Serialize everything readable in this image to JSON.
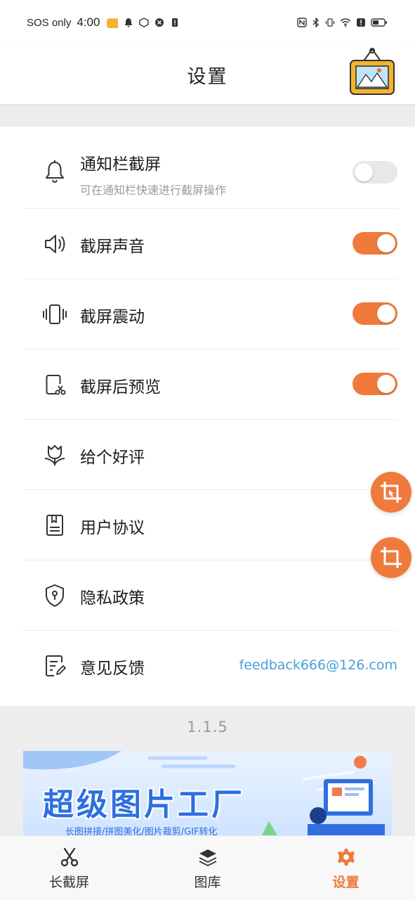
{
  "status_bar": {
    "carrier": "SOS only",
    "time": "4:00"
  },
  "header": {
    "title": "设置"
  },
  "settings": {
    "rows": [
      {
        "label": "通知栏截屏",
        "sub": "可在通知栏快速进行截屏操作",
        "toggle": false,
        "icon": "bell-icon"
      },
      {
        "label": "截屏声音",
        "toggle": true,
        "icon": "speaker-icon"
      },
      {
        "label": "截屏震动",
        "toggle": true,
        "icon": "vibrate-icon"
      },
      {
        "label": "截屏后预览",
        "toggle": true,
        "icon": "phone-scissors-icon"
      },
      {
        "label": "给个好评",
        "icon": "tulip-icon"
      },
      {
        "label": "用户协议",
        "icon": "document-icon"
      },
      {
        "label": "隐私政策",
        "icon": "shield-icon"
      },
      {
        "label": "意见反馈",
        "right_text": "feedback666@126.com",
        "icon": "edit-note-icon"
      }
    ]
  },
  "version": "1.1.5",
  "banner": {
    "title": "超级图片工厂",
    "subtitle": "长图拼接/拼图美化/图片裁剪/GIF转化"
  },
  "bottom_nav": {
    "items": [
      {
        "label": "长截屏",
        "icon": "scissors-icon",
        "active": false
      },
      {
        "label": "图库",
        "icon": "layers-icon",
        "active": false
      },
      {
        "label": "设置",
        "icon": "gear-icon",
        "active": true
      }
    ]
  },
  "colors": {
    "accent": "#ef7a3c",
    "link": "#4a9fd6",
    "toggle_off": "#e8e8e8"
  }
}
